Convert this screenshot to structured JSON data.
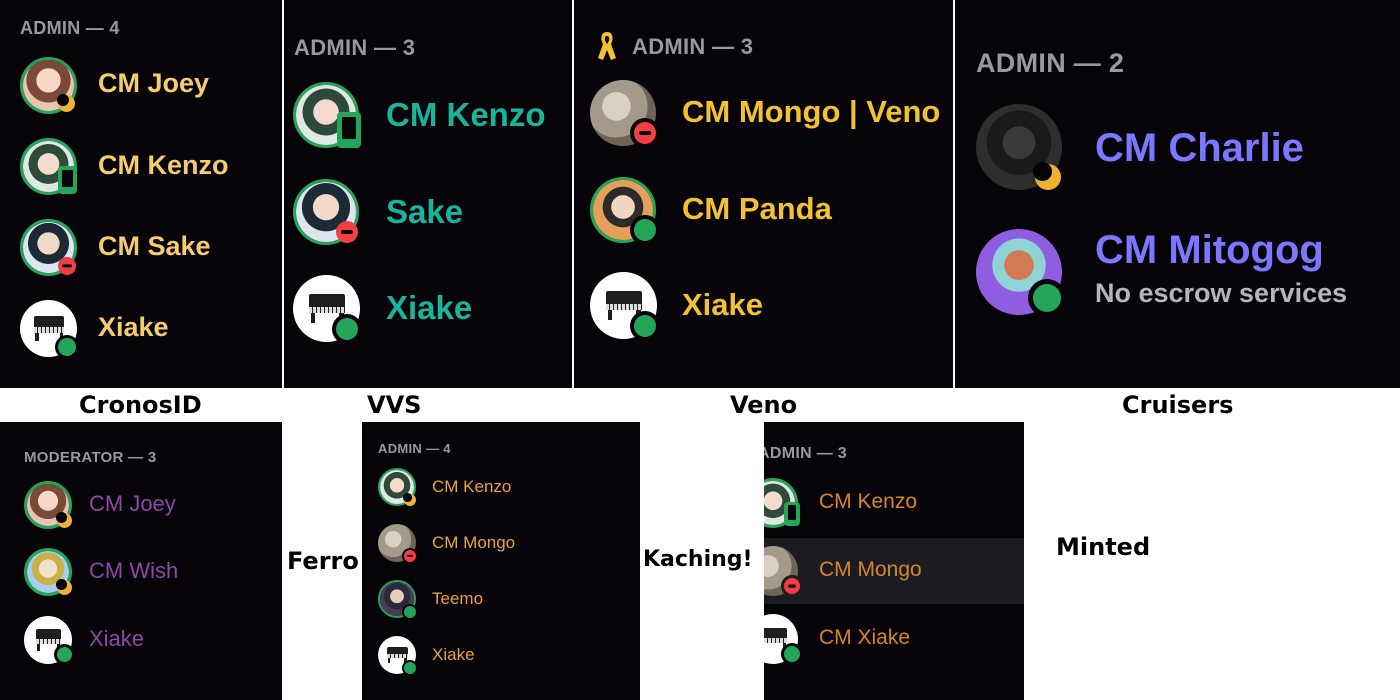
{
  "colors": {
    "panel_bg": "#060409",
    "online": "#23a55a",
    "dnd": "#f23f43",
    "idle": "#f0b232",
    "gold_name": "#f3cd6e",
    "teal_name": "#19b49c",
    "blurple_name": "#7b77ff",
    "purple_name": "#8e48a6",
    "orange_name": "#e8a241"
  },
  "panels": {
    "cronosid": {
      "header": "ADMIN — 4",
      "label": "CronosID",
      "members": [
        {
          "name": "CM Joey",
          "status": "idle",
          "avatar": "anime-girl-avatar"
        },
        {
          "name": "CM Kenzo",
          "status": "mobile",
          "avatar": "anime-boy-avatar"
        },
        {
          "name": "CM Sake",
          "status": "dnd",
          "avatar": "anime-boy-avatar"
        },
        {
          "name": "Xiake",
          "status": "online",
          "avatar": "piano-avatar"
        }
      ]
    },
    "vvs": {
      "header": "ADMIN — 3",
      "label": "VVS",
      "members": [
        {
          "name": "CM Kenzo",
          "status": "mobile",
          "avatar": "anime-boy-avatar"
        },
        {
          "name": "Sake",
          "status": "dnd",
          "avatar": "anime-boy-avatar"
        },
        {
          "name": "Xiake",
          "status": "online",
          "avatar": "piano-avatar"
        }
      ]
    },
    "veno": {
      "header": "ADMIN — 3",
      "header_icon": "yellow-ribbon-icon",
      "label": "Veno",
      "members": [
        {
          "name": "CM Mongo | Veno",
          "status": "dnd",
          "avatar": "mushroom-avatar"
        },
        {
          "name": "CM Panda",
          "status": "online",
          "avatar": "anime-boy-avatar"
        },
        {
          "name": "Xiake",
          "status": "online",
          "avatar": "piano-avatar"
        }
      ]
    },
    "cruisers": {
      "header": "ADMIN — 2",
      "label": "Cruisers",
      "members": [
        {
          "name": "CM Charlie",
          "status": "idle",
          "avatar": "helmet-avatar"
        },
        {
          "name": "CM Mitogog",
          "status": "online",
          "subtitle": "No escrow services",
          "avatar": "alien-avatar"
        }
      ]
    },
    "ferro": {
      "header": "MODERATOR — 3",
      "label": "Ferro",
      "members": [
        {
          "name": "CM Joey",
          "status": "idle",
          "avatar": "anime-girl-avatar"
        },
        {
          "name": "CM Wish",
          "status": "idle",
          "avatar": "anime-boy-avatar"
        },
        {
          "name": "Xiake",
          "status": "online",
          "avatar": "piano-avatar"
        }
      ]
    },
    "kaching": {
      "header": "ADMIN — 4",
      "label": "Kaching!",
      "members": [
        {
          "name": "CM Kenzo",
          "status": "idle",
          "avatar": "anime-boy-avatar"
        },
        {
          "name": "CM Mongo",
          "status": "dnd",
          "avatar": "mushroom-avatar"
        },
        {
          "name": "Teemo",
          "status": "online",
          "avatar": "anime-boy-avatar"
        },
        {
          "name": "Xiake",
          "status": "online",
          "avatar": "piano-avatar"
        }
      ]
    },
    "minted": {
      "header": "ADMIN — 3",
      "label": "Minted",
      "members": [
        {
          "name": "CM Kenzo",
          "status": "mobile",
          "avatar": "anime-boy-avatar"
        },
        {
          "name": "CM Mongo",
          "status": "dnd",
          "avatar": "mushroom-avatar"
        },
        {
          "name": "CM Xiake",
          "status": "online",
          "avatar": "piano-avatar"
        }
      ]
    }
  }
}
